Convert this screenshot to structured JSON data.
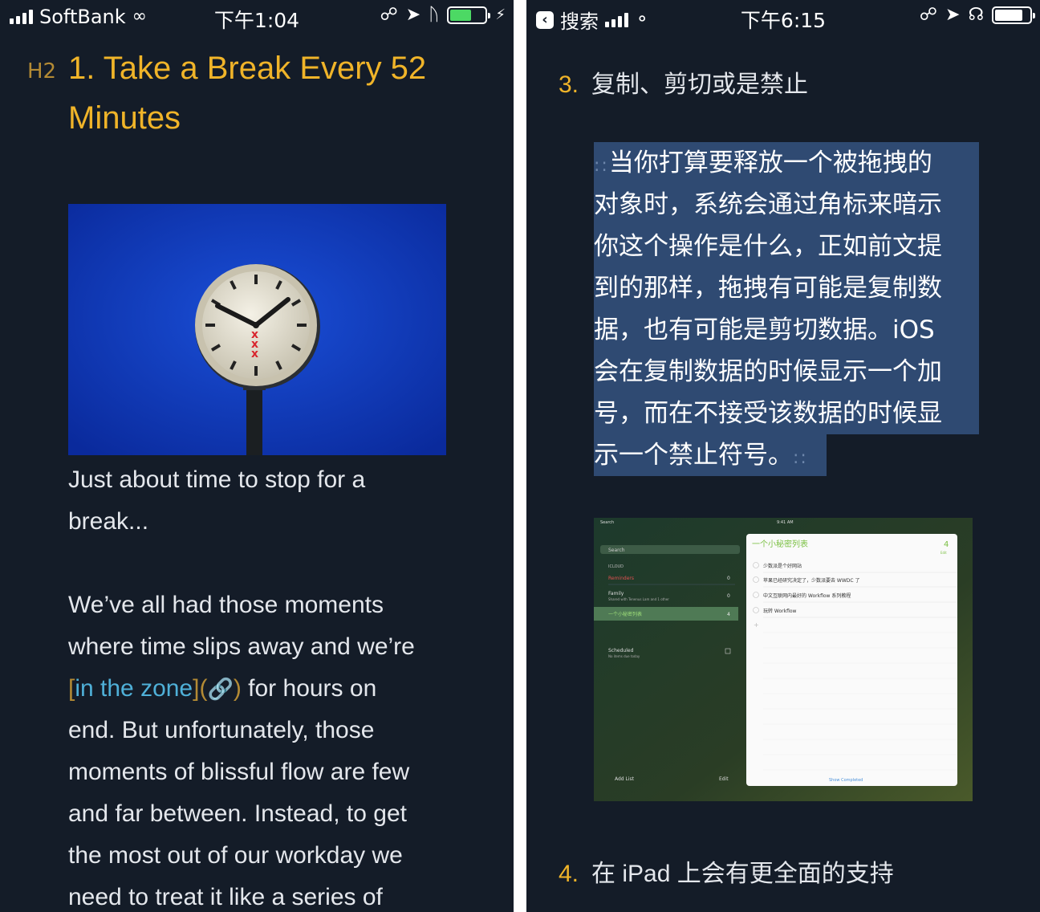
{
  "left": {
    "status": {
      "carrier": "SoftBank",
      "time": "下午1:04"
    },
    "h2_marker": "H2",
    "heading": "1. Take a Break Every 52 Minutes",
    "caption_lines": [
      "Just about time to stop for a",
      "break..."
    ],
    "body": {
      "line1": "We’ve all had those moments",
      "line2": "where time slips away and we’re",
      "link_open": "[",
      "link_text": "in the zone",
      "link_mid": "](",
      "link_close": ")",
      "link_after": " for hours on",
      "lines_rest": [
        "end. But unfortunately, those",
        "moments of blissful flow are few",
        "and far between. Instead, to get",
        "the most out of our workday we",
        "need to treat it like a series of"
      ]
    }
  },
  "right": {
    "status": {
      "back_label": "搜索",
      "time": "下午6:15"
    },
    "item3": {
      "number": "3.",
      "text": "复制、剪切或是禁止"
    },
    "selected_lines": [
      "当你打算要释放一个被拖拽的",
      "对象时，系统会通过角标来暗示",
      "你这个操作是什么，正如前文提",
      "到的那样，拖拽有可能是复制数",
      "据，也有可能是剪切数据。iOS",
      "会在复制数据的时候显示一个加",
      "号，而在不接受该数据的时候显",
      "示一个禁止符号。"
    ],
    "selection_handle": "::",
    "item4": {
      "number": "4.",
      "text": "在 iPad 上会有更全面的支持"
    },
    "ipad_shot": {
      "status_left": "Search",
      "status_time": "9:41 AM",
      "search_placeholder": "Search",
      "section": "ICLOUD",
      "lists": [
        {
          "name": "Reminders",
          "count": "0"
        },
        {
          "name": "Family",
          "sub": "Shared with Tenenus Lam and 1 other",
          "count": "0"
        },
        {
          "name": "一个小秘密列表",
          "count": "4"
        }
      ],
      "scheduled": "Scheduled",
      "scheduled_sub": "No items due today",
      "add_list": "Add List",
      "edit": "Edit",
      "detail_title": "一个小秘密列表",
      "detail_count": "4",
      "detail_edit": "Edit",
      "tasks": [
        "少数派是个好网站",
        "苹果已经研究决定了，少数派要去 WWDC 了",
        "中文互联网内最好的 Workflow 系列教程",
        "玩转 Workflow"
      ],
      "show_completed": "Show Completed"
    }
  },
  "colors": {
    "background": "#141c28",
    "heading": "#f0b429",
    "markdown_syntax": "#b38a34",
    "link": "#4fb0d8",
    "selection": "#2f4a72",
    "battery_left": "#4cd964",
    "battery_right": "#ffffff"
  }
}
